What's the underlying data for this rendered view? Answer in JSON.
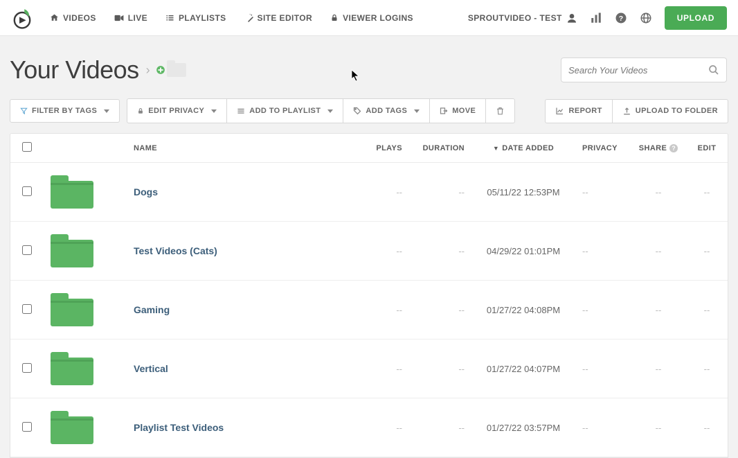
{
  "nav": {
    "videos": "VIDEOS",
    "live": "LIVE",
    "playlists": "PLAYLISTS",
    "site_editor": "SITE EDITOR",
    "viewer_logins": "VIEWER LOGINS",
    "account": "SPROUTVIDEO - TEST",
    "upload": "UPLOAD"
  },
  "page": {
    "title": "Your Videos",
    "search_placeholder": "Search Your Videos"
  },
  "toolbar": {
    "filter_tags": "FILTER BY TAGS",
    "edit_privacy": "EDIT PRIVACY",
    "add_playlist": "ADD TO PLAYLIST",
    "add_tags": "ADD TAGS",
    "move": "MOVE",
    "report": "REPORT",
    "upload_folder": "UPLOAD TO FOLDER"
  },
  "columns": {
    "name": "NAME",
    "plays": "PLAYS",
    "duration": "DURATION",
    "date_added": "DATE ADDED",
    "privacy": "PRIVACY",
    "share": "SHARE",
    "edit": "EDIT"
  },
  "rows": [
    {
      "name": "Dogs",
      "plays": "--",
      "duration": "--",
      "date": "05/11/22 12:53PM",
      "privacy": "--",
      "share": "--",
      "edit": "--"
    },
    {
      "name": "Test Videos (Cats)",
      "plays": "--",
      "duration": "--",
      "date": "04/29/22 01:01PM",
      "privacy": "--",
      "share": "--",
      "edit": "--"
    },
    {
      "name": "Gaming",
      "plays": "--",
      "duration": "--",
      "date": "01/27/22 04:08PM",
      "privacy": "--",
      "share": "--",
      "edit": "--"
    },
    {
      "name": "Vertical",
      "plays": "--",
      "duration": "--",
      "date": "01/27/22 04:07PM",
      "privacy": "--",
      "share": "--",
      "edit": "--"
    },
    {
      "name": "Playlist Test Videos",
      "plays": "--",
      "duration": "--",
      "date": "01/27/22 03:57PM",
      "privacy": "--",
      "share": "--",
      "edit": "--"
    }
  ]
}
